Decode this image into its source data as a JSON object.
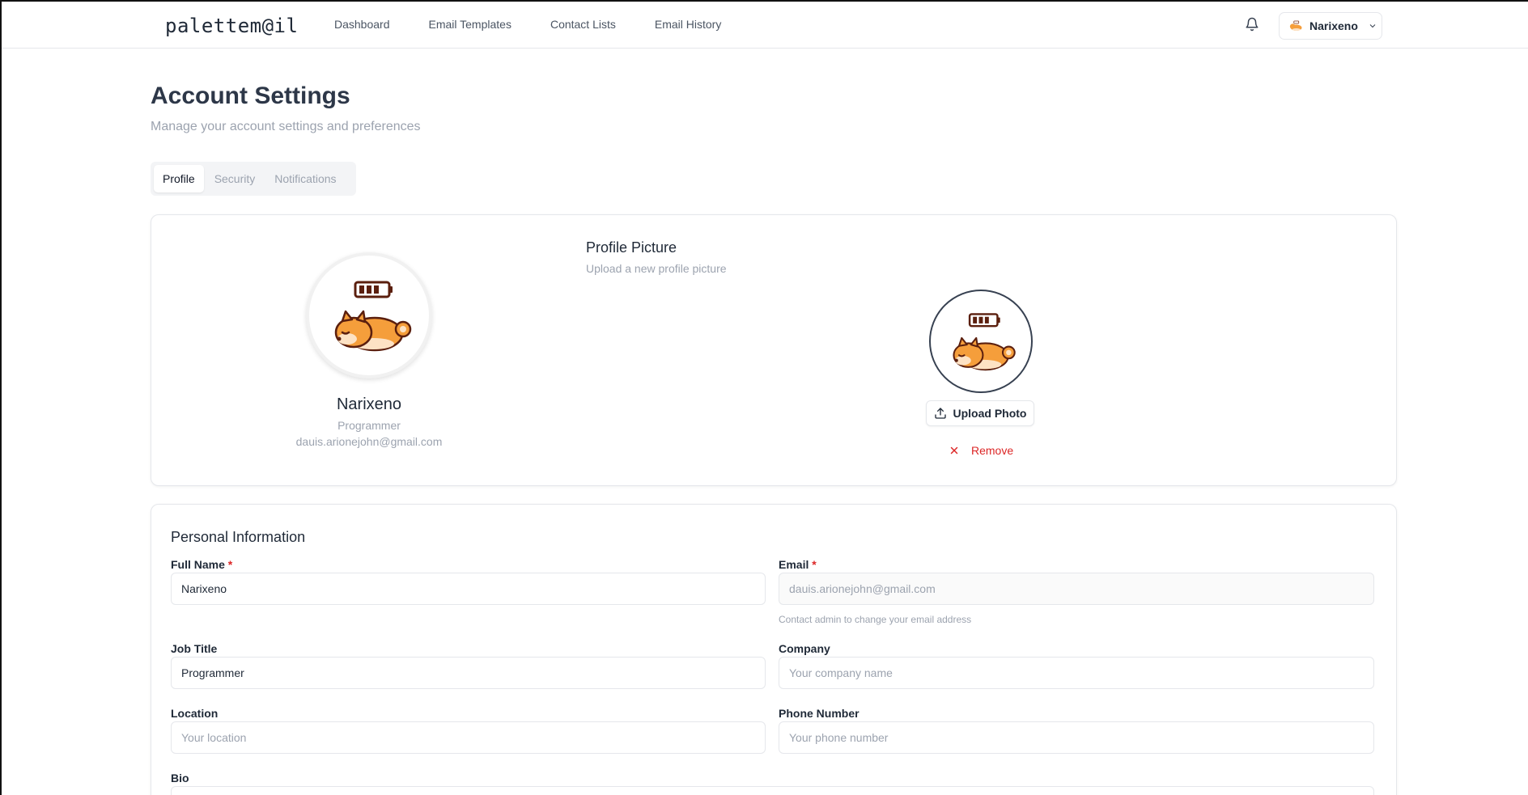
{
  "header": {
    "logo": "palettem@il",
    "nav": [
      "Dashboard",
      "Email Templates",
      "Contact Lists",
      "Email History"
    ],
    "user_name": "Narixeno"
  },
  "page": {
    "title": "Account Settings",
    "subtitle": "Manage your account settings and preferences"
  },
  "tabs": [
    {
      "label": "Profile",
      "active": true
    },
    {
      "label": "Security",
      "active": false
    },
    {
      "label": "Notifications",
      "active": false
    }
  ],
  "profile_card": {
    "name": "Narixeno",
    "job": "Programmer",
    "email": "dauis.arionejohn@gmail.com",
    "picture_title": "Profile Picture",
    "picture_subtitle": "Upload a new profile picture",
    "upload_label": "Upload Photo",
    "remove_label": "Remove"
  },
  "personal": {
    "title": "Personal Information",
    "full_name_label": "Full Name",
    "full_name_value": "Narixeno",
    "email_label": "Email",
    "email_value": "dauis.arionejohn@gmail.com",
    "email_hint": "Contact admin to change your email address",
    "job_label": "Job Title",
    "job_value": "Programmer",
    "company_label": "Company",
    "company_placeholder": "Your company name",
    "location_label": "Location",
    "location_placeholder": "Your location",
    "phone_label": "Phone Number",
    "phone_placeholder": "Your phone number",
    "bio_label": "Bio",
    "required_mark": "*"
  },
  "colors": {
    "accent_red": "#dc2626",
    "text_dark": "#1f2937",
    "muted": "#9ca3af",
    "dog_orange": "#f59e3b"
  }
}
